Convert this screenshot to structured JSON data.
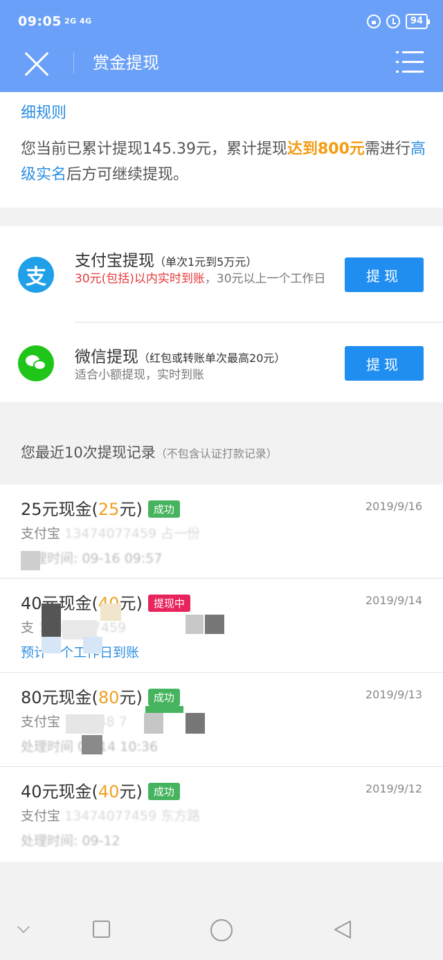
{
  "status_bar": {
    "time": "09:05",
    "signal": "2G 4G",
    "battery": "94"
  },
  "header": {
    "title": "赏金提现"
  },
  "rules": {
    "link": "细规则",
    "text_a": "您当前已累计提现145.39元，累计提现",
    "text_highlight": "达到800元",
    "text_b": "需进行",
    "text_link": "高级实名",
    "text_c": "后方可继续提现。"
  },
  "methods": [
    {
      "title": "支付宝提现",
      "note": "（单次1元到5万元）",
      "desc_red": "30元(包括)以内实时到账",
      "desc_rest": "，30元以上一个工作日",
      "button": "提现",
      "icon": "alipay-icon",
      "icon_char": "支"
    },
    {
      "title": "微信提现",
      "note_a": "（红包或转账单次最高",
      "note_red": "20元",
      "note_b": "）",
      "desc": "适合小额提现，实时到账",
      "button": "提现",
      "icon": "wechat-icon"
    }
  ],
  "records_header": {
    "title": "您最近10次提现记录",
    "note": "（不包含认证打款记录）"
  },
  "records": [
    {
      "prefix": "25元现金(",
      "amount": "25",
      "suffix": "元)",
      "status": "成功",
      "date": "2019/9/16",
      "line1_a": "支付宝",
      "line1_b": "13474077459 占一份",
      "line2": "处理时间: 09-16 09:57"
    },
    {
      "prefix": "40元现金(",
      "amount": "40",
      "suffix": "元)",
      "status": "提现中",
      "date": "2019/9/14",
      "line1_a": "支",
      "line1_b": "134745 7459",
      "line2": "预计一个工作日到账"
    },
    {
      "prefix": "80元现金(",
      "amount": "80",
      "suffix": "元)",
      "status": "成功",
      "date": "2019/9/13",
      "line1_a": "支付宝",
      "line1_b": "134748 7",
      "line2": "处理时间 09-14 10:36"
    },
    {
      "prefix": "40元现金(",
      "amount": "40",
      "suffix": "元)",
      "status": "成功",
      "date": "2019/9/12",
      "line1_a": "支付宝",
      "line1_b": "13474077459 东方路",
      "line2": "处理时间: 09-12"
    }
  ],
  "colors": {
    "header_bg": "#6aa0f7",
    "button_blue": "#1f8ef0",
    "success_green": "#46b35e",
    "pending_pink": "#e8245c",
    "amount_orange": "#f0a020"
  }
}
